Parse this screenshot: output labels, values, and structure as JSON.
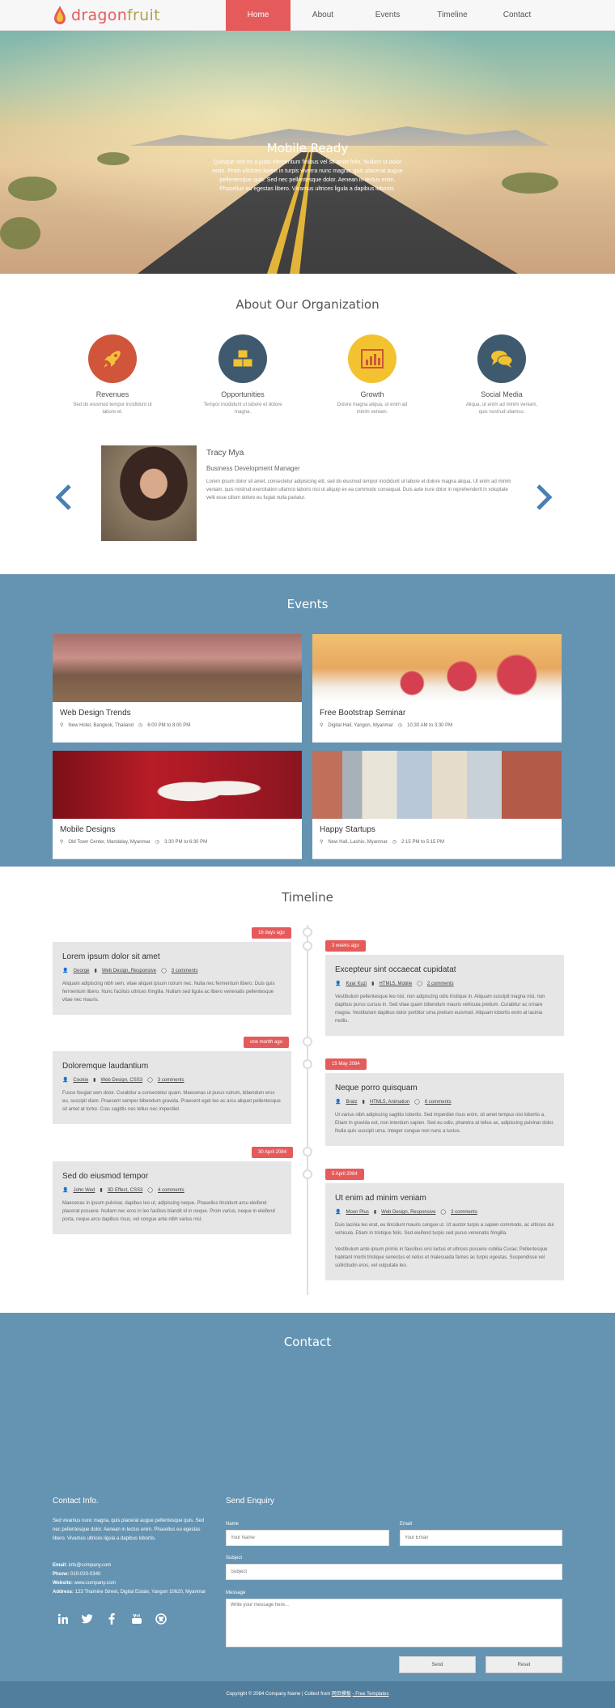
{
  "nav": {
    "logo_part1": "dragon",
    "logo_part2": "fruit",
    "items": [
      "Home",
      "About",
      "Events",
      "Timeline",
      "Contact"
    ],
    "active": "Home"
  },
  "hero": {
    "title": "Mobile Ready",
    "text": "Quisque sed ex a justo elementum finibus vel sit amet felis. Nullam ut dolor enim. Proin ultricies lorem in turpis viverra nunc magna, quis placerat augue pellentesque quis. Sed nec pellentesque dolor. Aenean in lectus enim. Phasellus eu egestas libero. Vivamus ultrices ligula a dapibus lobortis."
  },
  "about": {
    "title": "About Our Organization",
    "items": [
      {
        "label": "Revenues",
        "text": "Sed do eiusmod tempor incididunt ut labore et.",
        "icon": "rocket-icon",
        "color": "#d0553a"
      },
      {
        "label": "Opportunities",
        "text": "Tempor incididunt ut labore et dolore magna.",
        "icon": "cubes-icon",
        "color": "#3f5a6e"
      },
      {
        "label": "Growth",
        "text": "Dolore magna aliqua, ut enim ad minim veniam.",
        "icon": "bar-chart-icon",
        "color": "#f2c230"
      },
      {
        "label": "Social Media",
        "text": "Aliqua, ut enim ad minim veniam, quis nostrud ullamco.",
        "icon": "comments-icon",
        "color": "#3f5a6e"
      }
    ]
  },
  "testimonial": {
    "name": "Tracy Mya",
    "role": "Business Development Manager",
    "text": "Lorem ipsum dolor sit amet, consectetur adipisicing elit, sed do eiusmod tempor incididunt ut labore et dolore magna aliqua. Ut enim ad minim veniam, quis nostrud exercitation ullamco laboris nisi ut aliquip ex ea commodo consequat. Duis aute irure dolor in reprehenderit in voluptate velit esse cillum dolore eu fugiat nulla pariatur."
  },
  "events": {
    "title": "Events",
    "items": [
      {
        "title": "Web Design Trends",
        "location": "New Hotel, Bangkok, Thailand",
        "time": "6:00 PM to 8:00 PM"
      },
      {
        "title": "Free Bootstrap Seminar",
        "location": "Digital Hall, Yangon, Myanmar",
        "time": "10:30 AM to 3:30 PM"
      },
      {
        "title": "Mobile Designs",
        "location": "Old Town Center, Mandalay, Myanmar",
        "time": "3:30 PM to 6:30 PM"
      },
      {
        "title": "Happy Startups",
        "location": "New Hall, Lashio, Myanmar",
        "time": "2:15 PM to 5:15 PM"
      }
    ]
  },
  "timeline": {
    "title": "Timeline",
    "left": [
      {
        "badge": "16 days ago",
        "title": "Lorem ipsum dolor sit amet",
        "author": "George",
        "cat": "Web Design, Responsive",
        "comments": "3 comments",
        "paras": [
          "Aliquam adipiscing nibh sem, vitae aliquet ipsum rutrum nec. Nulla nec fermentum libero. Duis quis fermentum libero. Nunc facilisis ultrices fringilla. Nullam sed ligula ac libero venenatis pellentesque vitae nec mauris."
        ]
      },
      {
        "badge": "one month ago",
        "title": "Doloremque laudantium",
        "author": "Cookie",
        "cat": "Web Design, CSS3",
        "comments": "3 comments",
        "paras": [
          "Fusce feugiat sem dolor. Curabitur a consectetur quam. Maecenas ut purus rutrum, bibendum eros eu, suscipit diam. Praesent semper bibendum gravida. Praesent eget leo ac arcu aliquet pellentesque sit amet at tortor. Cras sagittis nec tellus nec imperdiet."
        ]
      },
      {
        "badge": "30 April 2084",
        "title": "Sed do eiusmod tempor",
        "author": "John Wed",
        "cat": "3D Effect, CSS3",
        "comments": "4 comments",
        "paras": [
          "Maecenas in ipsum pulvinar, dapibus leo ut, adipiscing neque. Phasellus tincidunt arcu eleifend placerat posuere. Nullam nec eros in leo facilisis blandit id in neque. Proin varius, neque in eleifend porta, neque arcu dapibus risus, vel congue ante nibh varius nisl."
        ]
      }
    ],
    "right": [
      {
        "badge": "3 weeks ago",
        "title": "Excepteur sint occaecat cupidatat",
        "author": "Kyar Kuzi",
        "cat": "HTML5, Mobile",
        "comments": "2 comments",
        "paras": [
          "Vestibulum pellentesque leo nisl, non adipiscing odio tristique in. Aliquam suscipit magna nisl, non dapibus purus cursus in. Sed vitae quam bibendum mauris vehicula pretium. Curabitur ac ornare magna. Vestibulum dapibus dolor porttitor urna pretium euismod. Aliquam lobortis enim at lacinia mollis."
        ]
      },
      {
        "badge": "15 May 2084",
        "title": "Neque porro quisquam",
        "author": "Bratz",
        "cat": "HTML5, Animation",
        "comments": "6 comments",
        "paras": [
          "Ut varius nibh adipiscing sagittis lobortis. Sed imperdiet risus enim, sit amet tempus nisi lobortis a. Etiam in gravida est, non interdum sapien. Sed eu odio, pharetra at tellus ac, adipiscing pulvinar dolor. Nulla quis suscipit urna. Integer congue non nunc a luctus."
        ]
      },
      {
        "badge": "5 April 2084",
        "title": "Ut enim ad minim veniam",
        "author": "Moon Plus",
        "cat": "Web Design, Responsive",
        "comments": "3 comments",
        "paras": [
          "Duis lacinia leo erat, eu tincidunt mauris congue ut. Ut auctor turpis a sapien commodo, ac ultrices dui vehicula. Etiam in tristique felis. Sed eleifend turpis sed purus venenatis fringilla.",
          "Vestibulum ante ipsum primis in faucibus orci luctus et ultrices posuere cubilia Curae; Pellentesque habitant morbi tristique senectus et netus et malesuada fames ac turpis egestas. Suspendisse vel sollicitudin eros, vel vulputate leo."
        ]
      }
    ]
  },
  "contact": {
    "title": "Contact",
    "info_title": "Contact Info.",
    "info_text": "Sed vivamus nunc magna, quis placerat augue pellentesque quis. Sed nec pellentesque dolor. Aenean in lectus enim. Phasellus eu egestas libero. Vivamus ultrices ligula a dapibus lobortis.",
    "email_label": "Email:",
    "email": "info@company.com",
    "phone_label": "Phone:",
    "phone": "010-020-0340",
    "website_label": "Website:",
    "website": "www.company.com",
    "address_label": "Address:",
    "address": "123 Thamine Street, Digital Estate, Yangon 10620, Myanmar",
    "form_title": "Send Enquiry",
    "name_label": "Name",
    "name_placeholder": "Your Name",
    "email_field_label": "Email",
    "email_placeholder": "Your Email",
    "subject_label": "Subject",
    "subject_placeholder": "Subject",
    "message_label": "Message",
    "message_placeholder": "Write your message here...",
    "send": "Send",
    "reset": "Reset",
    "social_icons": [
      "linkedin-icon",
      "twitter-icon",
      "facebook-icon",
      "youtube-icon",
      "github-icon"
    ]
  },
  "footer": {
    "copyright": "Copyright © 2084 Company Name",
    "collect": "| Collect from",
    "collect_link": "网页模板",
    "free": "- Free Templates"
  }
}
